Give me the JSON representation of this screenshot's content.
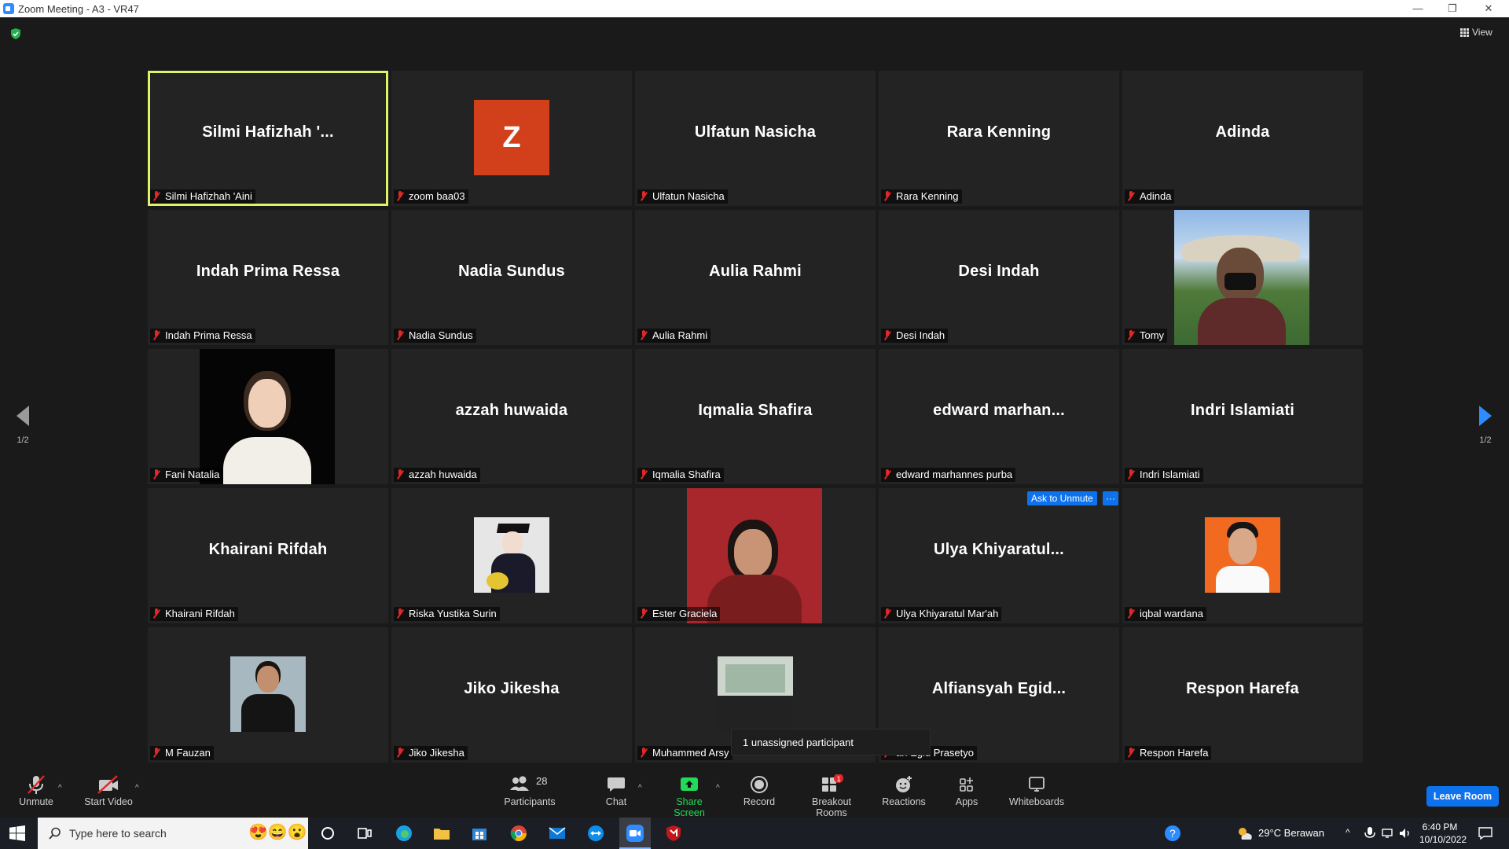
{
  "window": {
    "title": "Zoom Meeting - A3 - VR47"
  },
  "header": {
    "view_label": "View"
  },
  "tiles": [
    {
      "big": "Silmi  Hafizhah  '...",
      "label": "Silmi Hafizhah 'Aini"
    },
    {
      "big": "Z",
      "label": "zoom baa03"
    },
    {
      "big": "Ulfatun Nasicha",
      "label": "Ulfatun Nasicha"
    },
    {
      "big": "Rara Kenning",
      "label": "Rara Kenning"
    },
    {
      "big": "Adinda",
      "label": "Adinda"
    },
    {
      "big": "Indah Prima Ressa",
      "label": "Indah Prima Ressa"
    },
    {
      "big": "Nadia Sundus",
      "label": "Nadia Sundus"
    },
    {
      "big": "Aulia Rahmi",
      "label": "Aulia Rahmi"
    },
    {
      "big": "Desi Indah",
      "label": "Desi Indah"
    },
    {
      "big": "",
      "label": "Tomy"
    },
    {
      "big": "",
      "label": "Fani Natalia"
    },
    {
      "big": "azzah huwaida",
      "label": "azzah huwaida"
    },
    {
      "big": "Iqmalia Shafira",
      "label": "Iqmalia Shafira"
    },
    {
      "big": "edward  marhan...",
      "label": "edward marhannes purba"
    },
    {
      "big": "Indri Islamiati",
      "label": "Indri Islamiati"
    },
    {
      "big": "Khairani Rifdah",
      "label": "Khairani Rifdah"
    },
    {
      "big": "",
      "label": "Riska Yustika Surin"
    },
    {
      "big": "",
      "label": "Ester Graciela"
    },
    {
      "big": "Ulya  Khiyaratul...",
      "label": "Ulya Khiyaratul Mar'ah"
    },
    {
      "big": "",
      "label": "iqbal wardana"
    },
    {
      "big": "",
      "label": "M Fauzan"
    },
    {
      "big": "Jiko Jikesha",
      "label": "Jiko Jikesha"
    },
    {
      "big": "",
      "label": "Muhammed Arsy"
    },
    {
      "big": "Alfiansyah  Egid...",
      "label": "ah Egid Prasetyo"
    },
    {
      "big": "Respon Harefa",
      "label": "Respon Harefa"
    }
  ],
  "ask_to_unmute": {
    "label": "Ask to Unmute",
    "more": "···"
  },
  "pagination": {
    "left": "1/2",
    "right": "1/2"
  },
  "tooltip": "1 unassigned participant",
  "toolbar": {
    "unmute": "Unmute",
    "start_video": "Start Video",
    "participants": "Participants",
    "participants_count": "28",
    "chat": "Chat",
    "share_screen": "Share Screen",
    "record": "Record",
    "breakout_rooms": "Breakout Rooms",
    "breakout_badge": "1",
    "reactions": "Reactions",
    "apps": "Apps",
    "whiteboards": "Whiteboards",
    "leave": "Leave Room"
  },
  "taskbar": {
    "search_placeholder": "Type here to search",
    "weather": "29°C  Berawan",
    "time": "6:40 PM",
    "date": "10/10/2022"
  },
  "colors": {
    "active_speaker": "#e0f266",
    "brand": "#0e72ed",
    "share": "#23d959",
    "muted": "#e02828",
    "avatar_z": "#d2401b"
  }
}
